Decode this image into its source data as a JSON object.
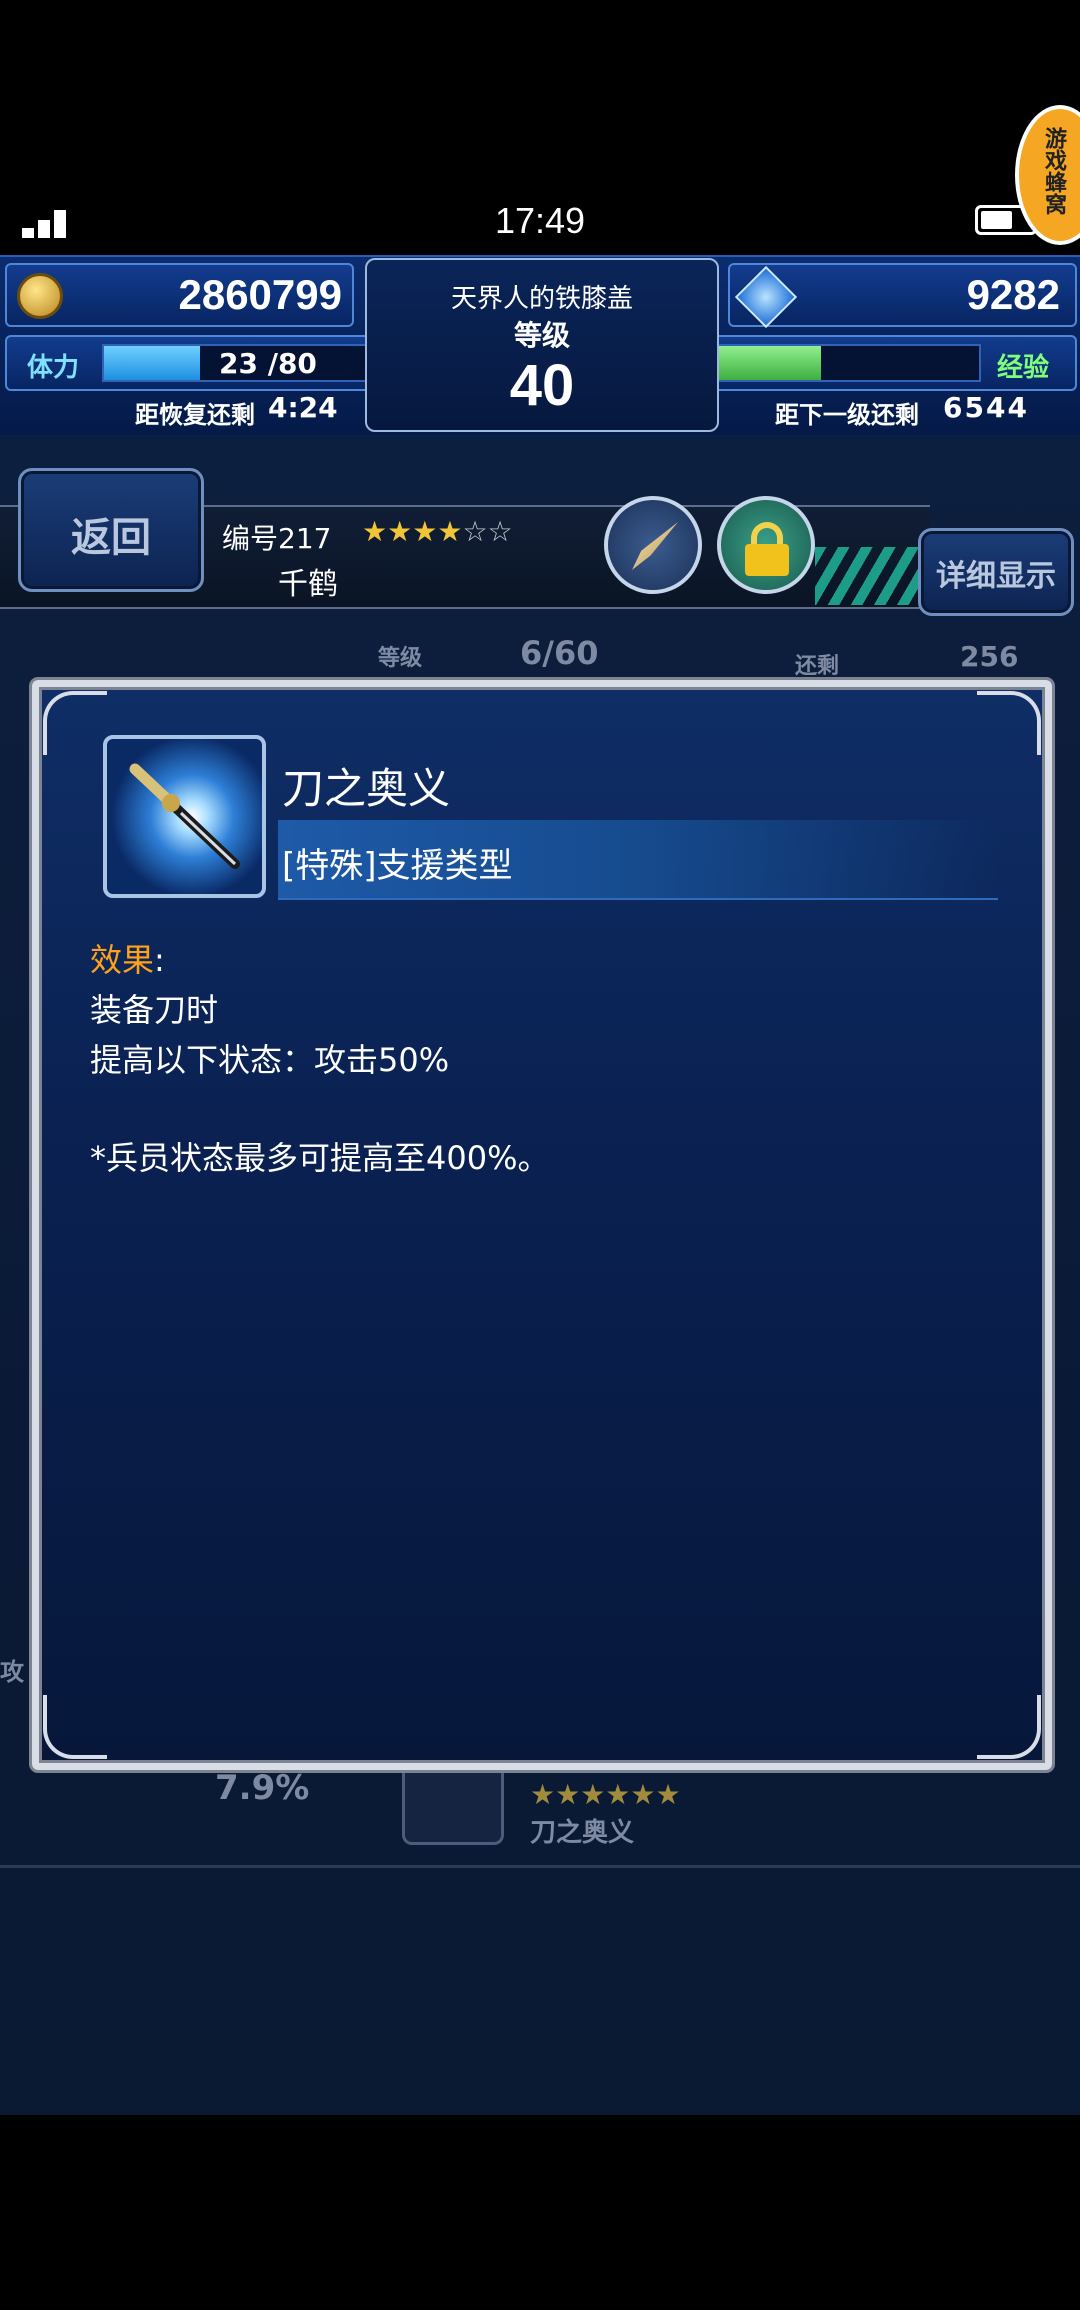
{
  "status_bar": {
    "time": "17:49",
    "badge_text": "游戏蜂窝"
  },
  "header": {
    "gil": "2860799",
    "title": "天界人的铁膝盖",
    "level_label": "等级",
    "level": "40",
    "lapis": "9282",
    "stamina_label": "体力",
    "stamina_value": "23 /80",
    "stamina_fill": 0.29,
    "recover_label": "距恢复还剩",
    "recover_time": "4:24",
    "exp_label": "经验",
    "exp_fill": 0.52,
    "next_label": "距下一级还剩",
    "next_value": "6544"
  },
  "unit": {
    "back_label": "返回",
    "detail_label": "详细显示",
    "number": "编号217",
    "stars_filled": 4,
    "stars_total": 6,
    "name": "千鹤",
    "level_label": "等级",
    "level_value": "6/60",
    "remain_label": "还剩",
    "remain_value": "256"
  },
  "behind": {
    "percent": "7.9%",
    "ability_name": "刀之奥义",
    "ability_stars": "★★★★★★",
    "attack_fragment": "攻"
  },
  "modal": {
    "ability_name": "刀之奥义",
    "type": "[特殊]支援类型",
    "effect_label": "效果",
    "effect_colon": ":",
    "line1": "装备刀时",
    "line2": "提高以下状态：攻击50%",
    "note": "*兵员状态最多可提高至400%。"
  }
}
